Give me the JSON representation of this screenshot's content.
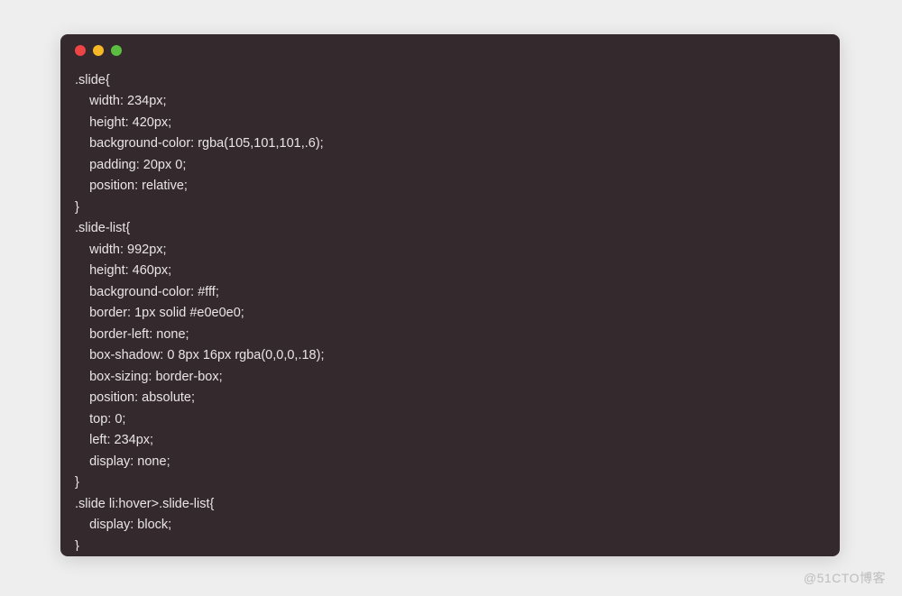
{
  "window": {
    "dots": [
      {
        "name": "close",
        "color": "#ed4444"
      },
      {
        "name": "minimize",
        "color": "#f7b828"
      },
      {
        "name": "zoom",
        "color": "#5bbe41"
      }
    ]
  },
  "code_lines": [
    ".slide{",
    "    width: 234px;",
    "    height: 420px;",
    "    background-color: rgba(105,101,101,.6);",
    "    padding: 20px 0;",
    "    position: relative;",
    "}",
    ".slide-list{",
    "    width: 992px;",
    "    height: 460px;",
    "    background-color: #fff;",
    "    border: 1px solid #e0e0e0;",
    "    border-left: none;",
    "    box-shadow: 0 8px 16px rgba(0,0,0,.18);",
    "    box-sizing: border-box;",
    "    position: absolute;",
    "    top: 0;",
    "    left: 234px;",
    "    display: none;",
    "}",
    ".slide li:hover>.slide-list{",
    "    display: block;",
    "}"
  ],
  "watermark": "@51CTO博客"
}
